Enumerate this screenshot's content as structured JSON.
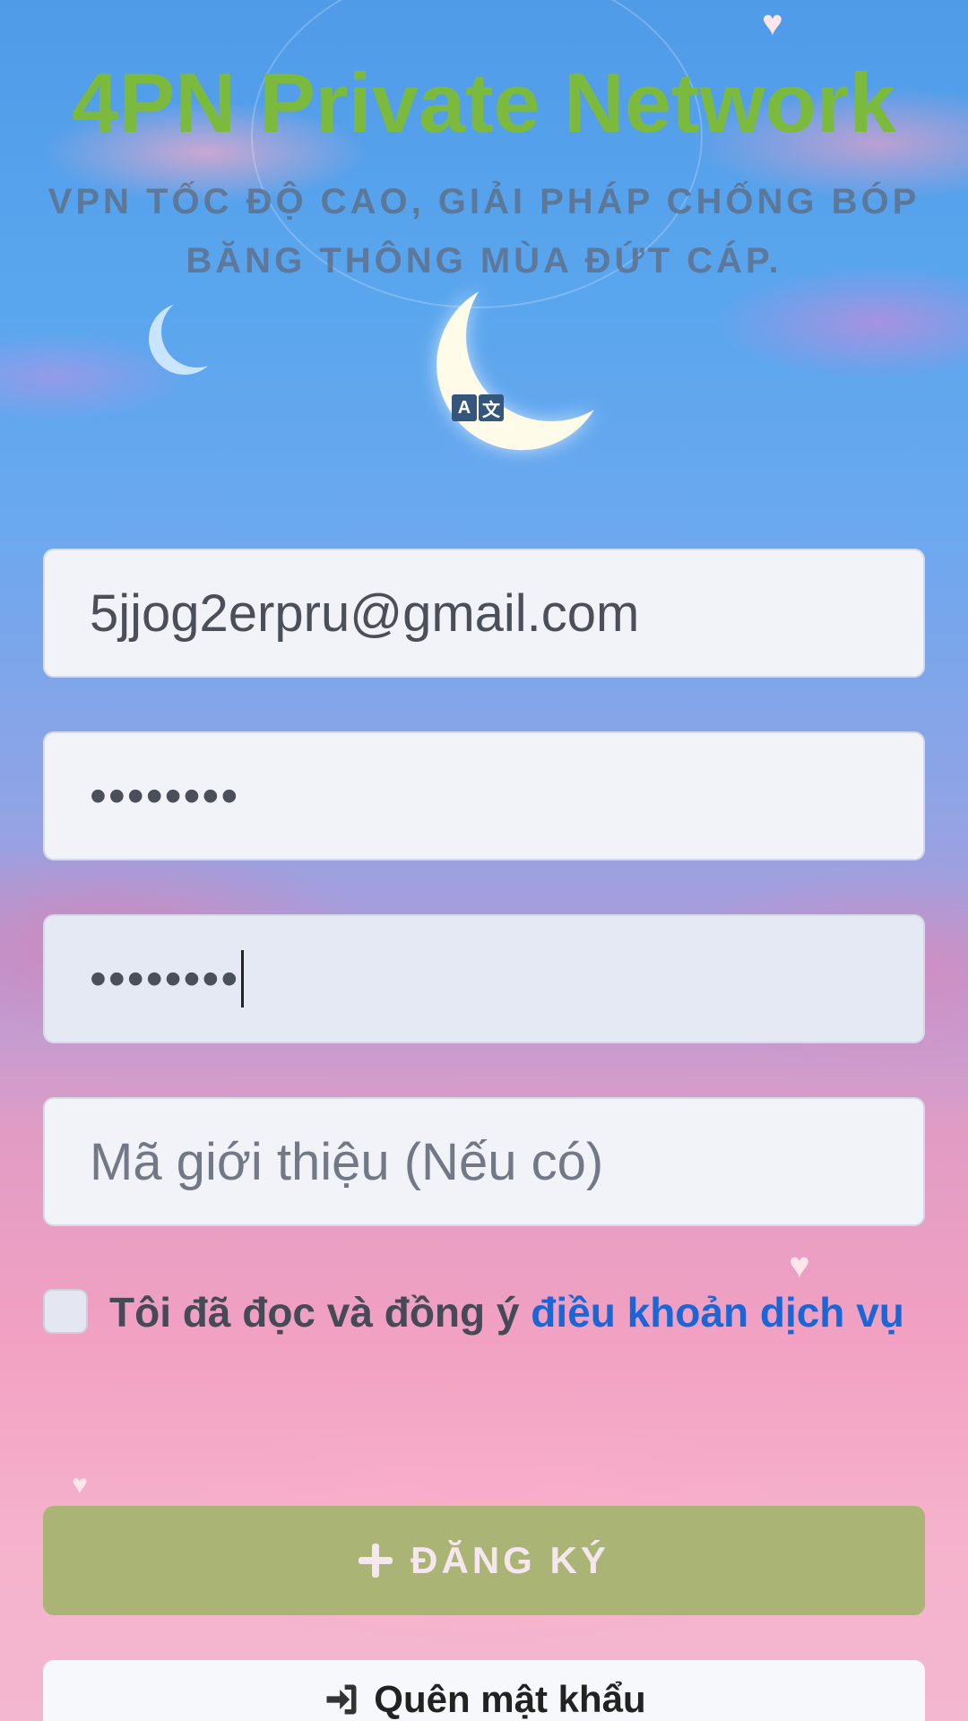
{
  "header": {
    "title": "4PN Private Network",
    "subtitle": "VPN TỐC ĐỘ CAO, GIẢI PHÁP CHỐNG BÓP BĂNG THÔNG MÙA ĐỨT CÁP.",
    "translate_icon": "translate-icon"
  },
  "form": {
    "email_value": "5jjog2erpru@gmail.com",
    "password_value": "••••••••",
    "confirm_password_value": "••••••••",
    "referral_placeholder": "Mã giới thiệu (Nếu có)",
    "terms_text": "Tôi đã đọc và đồng ý ",
    "terms_link": "điều khoản dịch vụ",
    "terms_checked": false
  },
  "buttons": {
    "register_label": "ĐĂNG KÝ",
    "register_icon": "plus-icon",
    "forgot_label": "Quên mật khẩu",
    "forgot_icon": "sign-in-icon"
  },
  "colors": {
    "title": "#7cba3e",
    "register_button": "#a3b56e",
    "link": "#1a66d6"
  }
}
